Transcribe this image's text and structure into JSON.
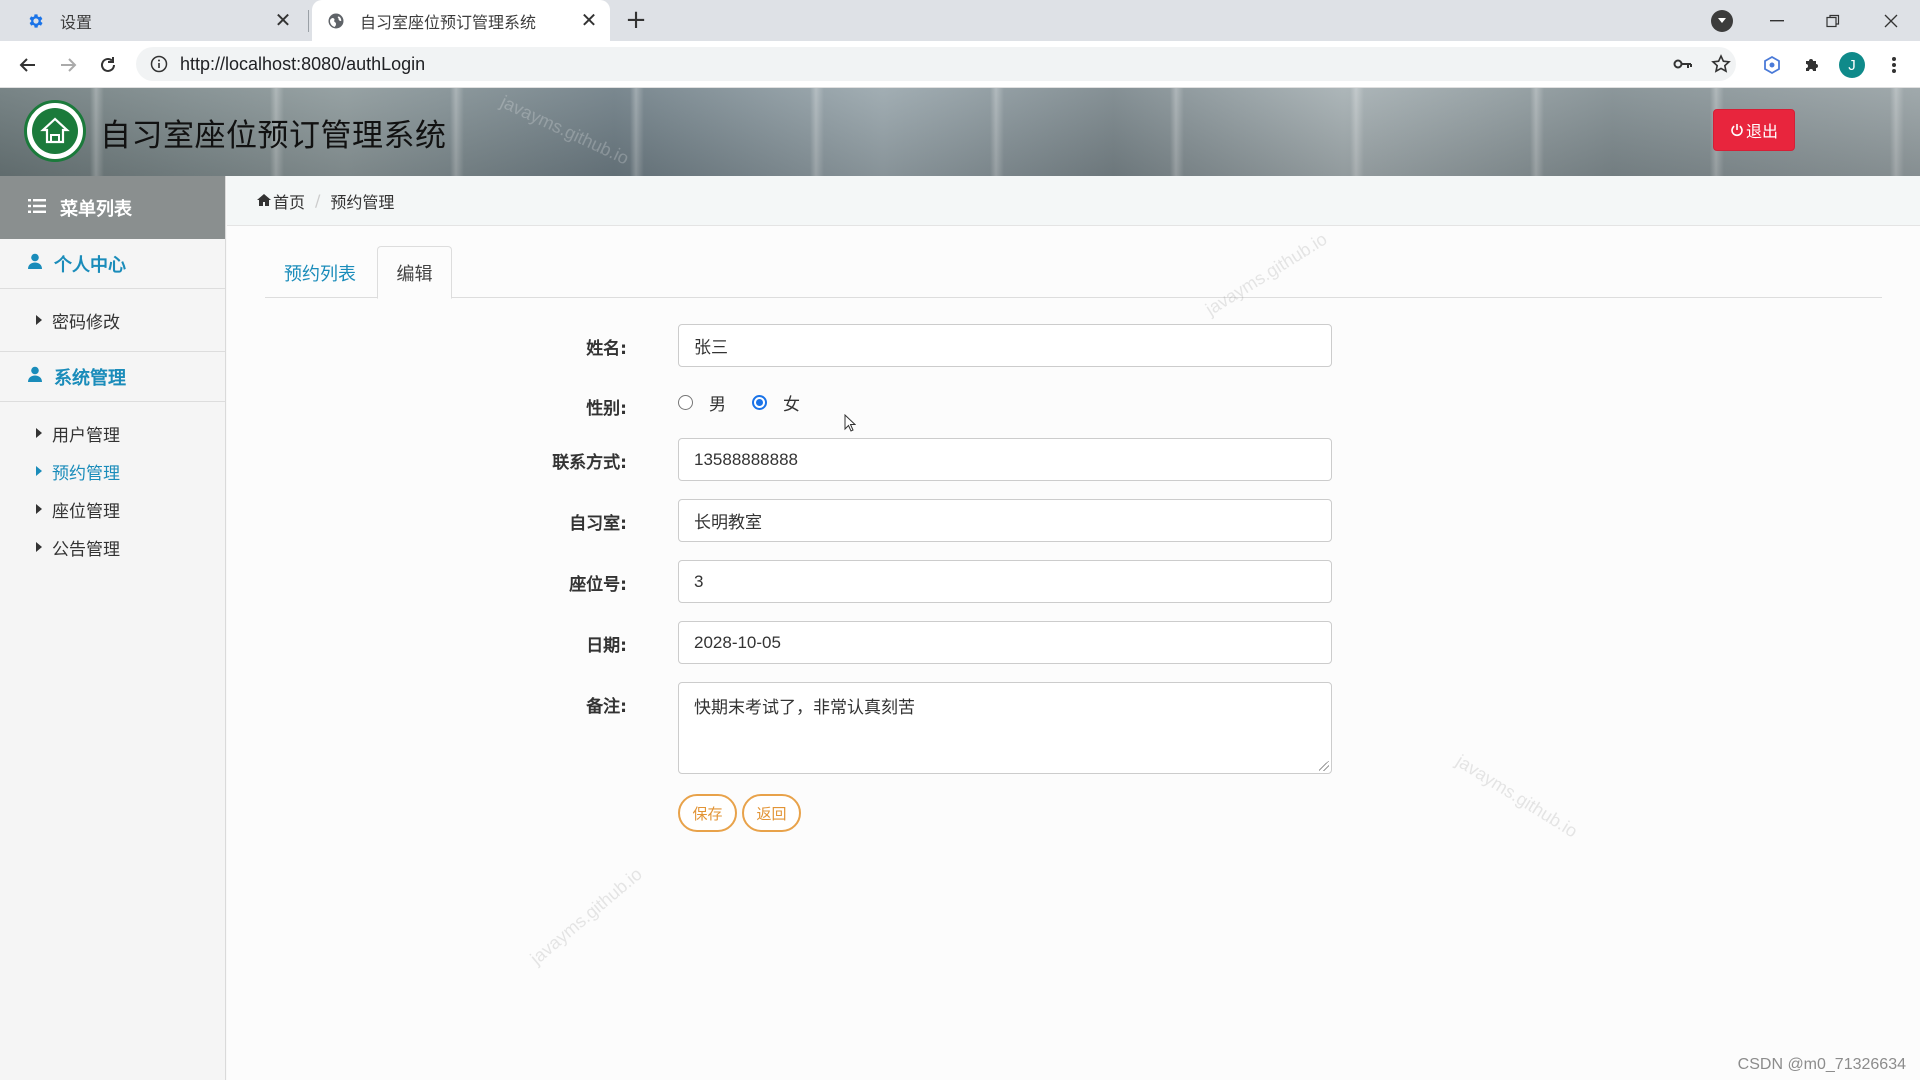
{
  "browser": {
    "tabs": [
      {
        "title": "设置",
        "icon": "gear-icon"
      },
      {
        "title": "自习室座位预订管理系统",
        "icon": "globe-icon"
      }
    ],
    "url": "http://localhost:8080/authLogin",
    "profile_initial": "J"
  },
  "header": {
    "title": "自习室座位预订管理系统",
    "logout_label": "退出",
    "logout_color": "#e8253d"
  },
  "sidebar": {
    "menu_title": "菜单列表",
    "groups": [
      {
        "label": "个人中心",
        "items": [
          {
            "label": "密码修改"
          }
        ]
      },
      {
        "label": "系统管理",
        "items": [
          {
            "label": "用户管理"
          },
          {
            "label": "预约管理",
            "active": true
          },
          {
            "label": "座位管理"
          },
          {
            "label": "公告管理"
          }
        ]
      }
    ],
    "accent_color": "#1a8cba"
  },
  "breadcrumb": {
    "home": "首页",
    "current": "预约管理"
  },
  "tabs": {
    "list": "预约列表",
    "edit": "编辑",
    "active": "edit"
  },
  "form": {
    "name": {
      "label": "姓名:",
      "value": "张三"
    },
    "gender": {
      "label": "性别:",
      "options": [
        "男",
        "女"
      ],
      "selected": "女"
    },
    "contact": {
      "label": "联系方式:",
      "value": "13588888888"
    },
    "room": {
      "label": "自习室:",
      "value": "长明教室"
    },
    "seat": {
      "label": "座位号:",
      "value": "3"
    },
    "date": {
      "label": "日期:",
      "value": "2028-10-05"
    },
    "note": {
      "label": "备注:",
      "value": "快期末考试了，非常认真刻苦"
    },
    "save_label": "保存",
    "back_label": "返回"
  },
  "watermark_text": "javayms.github.io",
  "credit": "CSDN @m0_71326634"
}
